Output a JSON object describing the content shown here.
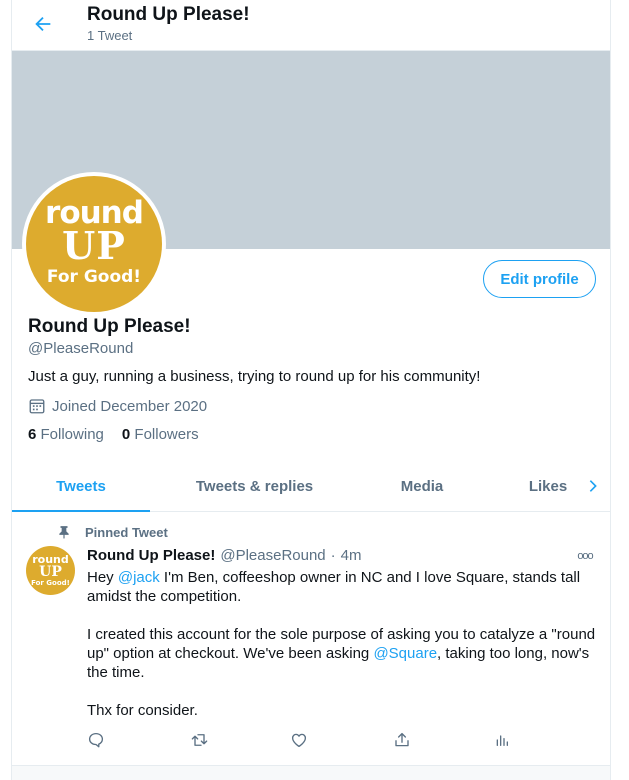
{
  "header": {
    "title": "Round Up Please!",
    "tweet_count": "1 Tweet"
  },
  "profile": {
    "avatar_logo": {
      "line1": "round",
      "line2": "UP",
      "line3": "For Good!"
    },
    "edit_button": "Edit profile",
    "name": "Round Up Please!",
    "handle": "@PleaseRound",
    "bio": "Just a guy, running a business, trying to round up for his community!",
    "joined": "Joined December 2020",
    "following_count": "6",
    "following_label": "Following",
    "followers_count": "0",
    "followers_label": "Followers"
  },
  "tabs": [
    {
      "label": "Tweets",
      "active": true
    },
    {
      "label": "Tweets & replies",
      "active": false
    },
    {
      "label": "Media",
      "active": false
    },
    {
      "label": "Likes",
      "active": false
    }
  ],
  "tweet": {
    "pinned_label": "Pinned Tweet",
    "name": "Round Up Please!",
    "handle": "@PleaseRound",
    "dot": "·",
    "time": "4m",
    "more": "ooo",
    "p1_before": "Hey ",
    "p1_mention": "@jack",
    "p1_after": " I'm Ben, coffeeshop owner in NC and I love Square, stands tall amidst the competition.",
    "p2_before": "I created this account for the sole purpose of asking you to catalyze a \"round up\" option at checkout. We've been asking ",
    "p2_mention": "@Square",
    "p2_after": ", taking too long, now's the time.",
    "p3": "Thx for consider."
  },
  "icons": {
    "back": "back-arrow-icon",
    "calendar": "calendar-icon",
    "pin": "pin-icon",
    "next": "chevron-right-icon",
    "reply": "reply-icon",
    "retweet": "retweet-icon",
    "like": "heart-icon",
    "share": "share-icon",
    "analytics": "analytics-icon"
  },
  "colors": {
    "accent": "#1da1f2",
    "banner": "#c5d0d8",
    "logo": "#ddab2e",
    "secondary_text": "#5b7083"
  }
}
